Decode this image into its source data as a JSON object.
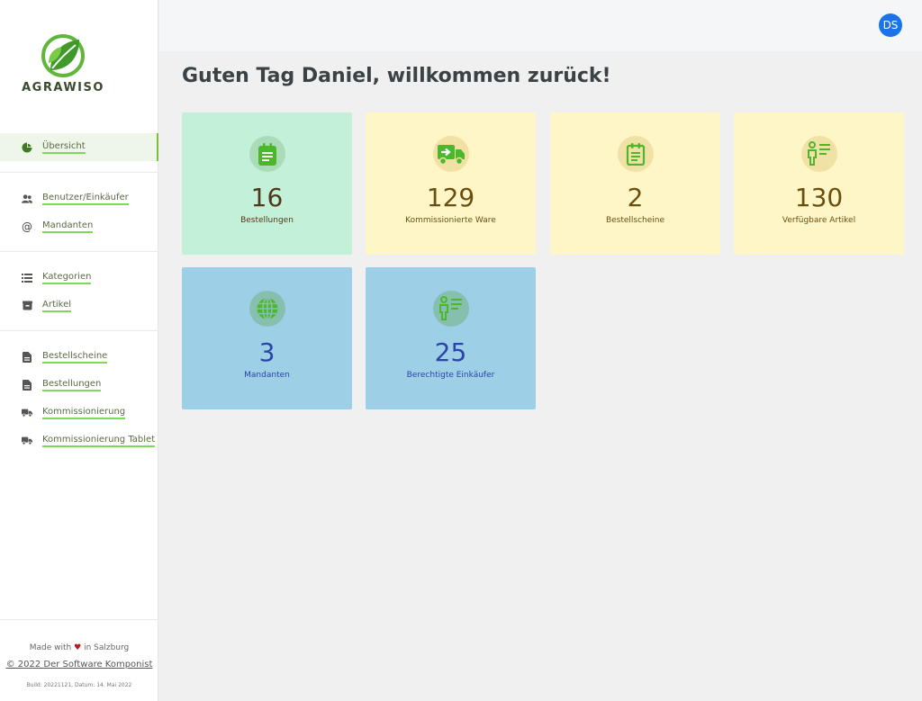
{
  "brand": {
    "name": "AGRAWISO"
  },
  "nav": {
    "groups": [
      [
        {
          "label": "Übersicht",
          "icon": "pie-chart-icon",
          "active": true
        }
      ],
      [
        {
          "label": "Benutzer/Einkäufer",
          "icon": "users-icon"
        },
        {
          "label": "Mandanten",
          "icon": "at-icon"
        }
      ],
      [
        {
          "label": "Kategorien",
          "icon": "list-icon"
        },
        {
          "label": "Artikel",
          "icon": "box-icon"
        }
      ],
      [
        {
          "label": "Bestellscheine",
          "icon": "document-icon"
        },
        {
          "label": "Bestellungen",
          "icon": "document-icon"
        },
        {
          "label": "Kommissionierung",
          "icon": "truck-icon"
        },
        {
          "label": "Kommissionierung Tablet",
          "icon": "truck-icon"
        }
      ]
    ]
  },
  "footer": {
    "made_prefix": "Made with",
    "made_suffix": "in Salzburg",
    "copyright": "© 2022 Der Software Komponist",
    "build": "Build: 20221121, Datum: 14. Mai 2022"
  },
  "user": {
    "initials": "DS"
  },
  "greeting": "Guten Tag Daniel, willkommen zurück!",
  "cards": [
    {
      "value": "16",
      "label": "Bestellungen",
      "icon": "clipboard-icon",
      "color": "#c3f0d9"
    },
    {
      "value": "129",
      "label": "Kommissionierte Ware",
      "icon": "truck-icon",
      "color": "#fff6c8"
    },
    {
      "value": "2",
      "label": "Bestellscheine",
      "icon": "notepad-icon",
      "color": "#fff6c8"
    },
    {
      "value": "130",
      "label": "Verfügbare Artikel",
      "icon": "person-list-icon",
      "color": "#fff6c8"
    },
    {
      "value": "3",
      "label": "Mandanten",
      "icon": "globe-icon",
      "color": "#9dd0e6"
    },
    {
      "value": "25",
      "label": "Berechtigte Einkäufer",
      "icon": "person-list-icon",
      "color": "#9dd0e6"
    }
  ],
  "accent": "#7cbf3a"
}
